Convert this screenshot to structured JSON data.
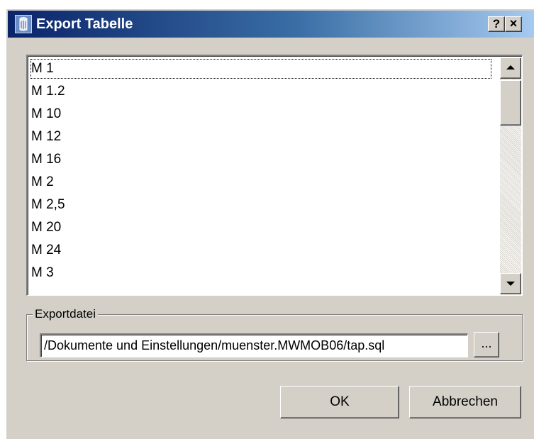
{
  "window": {
    "title": "Export Tabelle",
    "help_label": "?",
    "close_label": "×",
    "colors": {
      "title_start": "#0a246a",
      "title_end": "#a6caf0",
      "face": "#d4d0c8"
    }
  },
  "list": {
    "items": [
      "M 1",
      "M 1.2",
      "M 10",
      "M 12",
      "M 16",
      "M 2",
      "M 2,5",
      "M 20",
      "M 24",
      "M 3"
    ]
  },
  "export": {
    "group_label": "Exportdatei",
    "path_value": "/Dokumente und Einstellungen/muenster.MWMOB06/tap.sql",
    "browse_label": "..."
  },
  "buttons": {
    "ok_label": "OK",
    "cancel_label": "Abbrechen"
  }
}
